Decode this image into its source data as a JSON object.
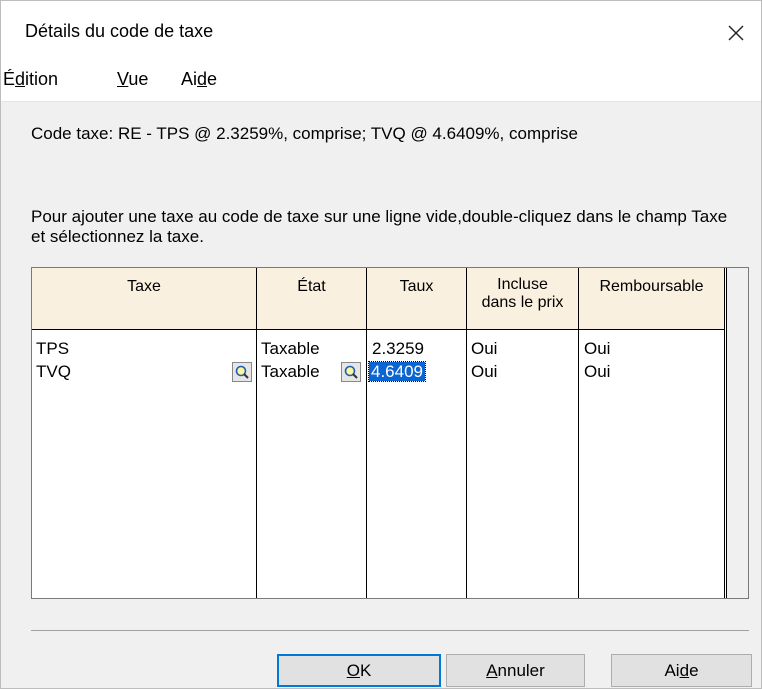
{
  "window": {
    "title": "Détails du code de taxe",
    "close_icon": "close-icon"
  },
  "menu": {
    "items": [
      {
        "pre": "É",
        "underlined": "d",
        "post": "ition"
      },
      {
        "pre": "",
        "underlined": "V",
        "post": "ue"
      },
      {
        "pre": "Ai",
        "underlined": "d",
        "post": "e"
      }
    ]
  },
  "code_line": "Code taxe: RE - TPS @ 2.3259%, comprise; TVQ @ 4.6409%, comprise",
  "instruction": "Pour ajouter une taxe au code de taxe sur une ligne vide,double-cliquez dans le champ Taxe et sélectionnez la taxe.",
  "grid": {
    "headers": {
      "taxe": "Taxe",
      "etat": "État",
      "taux": "Taux",
      "incluse_1": "Incluse",
      "incluse_2": "dans le prix",
      "remboursable": "Remboursable"
    },
    "rows": [
      {
        "taxe": "TPS",
        "etat": "Taxable",
        "taux": "2.3259",
        "incluse": "Oui",
        "remboursable": "Oui"
      },
      {
        "taxe": "TVQ",
        "etat": "Taxable",
        "taux": "4.6409",
        "incluse": "Oui",
        "remboursable": "Oui"
      }
    ]
  },
  "buttons": {
    "ok": {
      "underlined": "O",
      "post": "K"
    },
    "annuler": {
      "underlined": "A",
      "post": "nnuler"
    },
    "aide": {
      "pre": "Ai",
      "underlined": "d",
      "post": "e"
    }
  }
}
